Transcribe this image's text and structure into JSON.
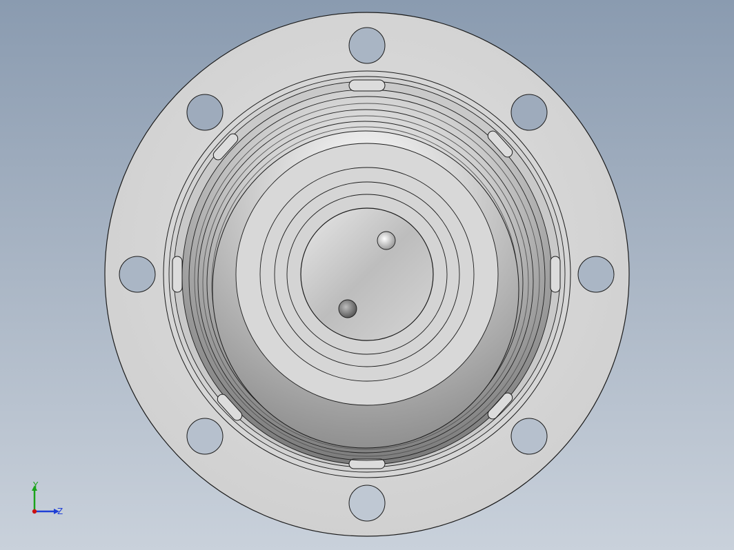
{
  "viewport": {
    "background_top": "#8a9bb0",
    "background_bottom": "#c9d1db"
  },
  "model": {
    "description_visible": "",
    "colors": {
      "face": "#d9d9d9",
      "edge": "#1a1a1a",
      "hole": "#aab5c4"
    },
    "flange_bolt_holes": 8
  },
  "triad": {
    "y_label": "Y",
    "z_label": "Z",
    "y_color": "#1aa31a",
    "z_color": "#1f3fd6",
    "origin_color": "#cc1111"
  }
}
